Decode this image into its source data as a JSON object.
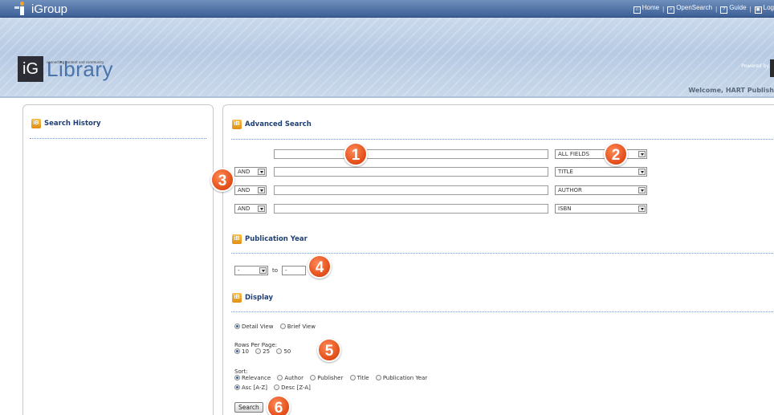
{
  "topbar": {
    "brand": "iGroup",
    "links": [
      {
        "icon": "home-icon",
        "label": "Home"
      },
      {
        "icon": "opensearch-icon",
        "label": "OpenSearch"
      },
      {
        "icon": "guide-icon",
        "label": "Guide"
      },
      {
        "icon": "lock-icon",
        "label": "Log"
      }
    ]
  },
  "header": {
    "logo_mark": "iG",
    "logo_text": "Library",
    "logo_tagline": "connecting content and community",
    "powered_by": "Powered by",
    "welcome": "Welcome, HART Publish"
  },
  "search_history": {
    "title": "Search History"
  },
  "advanced_search": {
    "title": "Advanced Search",
    "rows": [
      {
        "operator": "",
        "value": "",
        "field": "ALL FIELDS"
      },
      {
        "operator": "AND",
        "value": "",
        "field": "TITLE"
      },
      {
        "operator": "AND",
        "value": "",
        "field": "AUTHOR"
      },
      {
        "operator": "AND",
        "value": "",
        "field": "ISBN"
      }
    ]
  },
  "publication_year": {
    "title": "Publication Year",
    "from": "-",
    "to_label": "to",
    "to": "-"
  },
  "display": {
    "title": "Display",
    "views": [
      "Detail View",
      "Brief View"
    ],
    "selected_view": "Detail View",
    "rows_label": "Rows Per Page:",
    "rows_options": [
      "10",
      "25",
      "50"
    ],
    "selected_rows": "10",
    "sort_label": "Sort:",
    "sort_options": [
      "Relevance",
      "Author",
      "Publisher",
      "Title",
      "Publication Year"
    ],
    "order_options": [
      "Asc [A-Z]",
      "Desc [Z-A]"
    ],
    "search_button": "Search"
  },
  "callouts": [
    "1",
    "2",
    "3",
    "4",
    "5",
    "6"
  ],
  "colors": {
    "topbar": "#3c5f96",
    "heading": "#1f3f74",
    "callout": "#e4501b",
    "section_icon": "#e08f13"
  }
}
